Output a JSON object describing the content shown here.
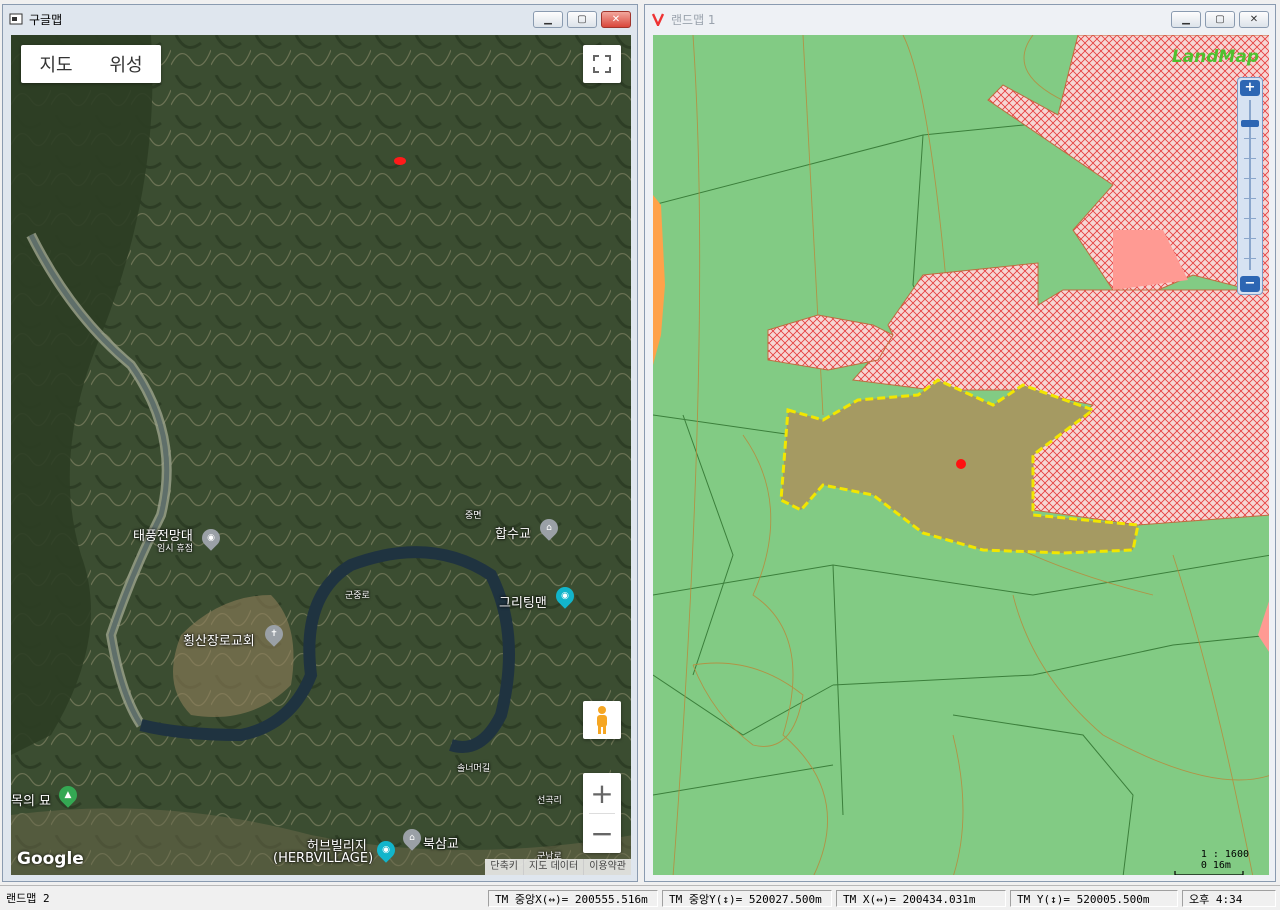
{
  "google_window": {
    "title": "구글맵",
    "map_type": {
      "map": "지도",
      "satellite": "위성"
    },
    "places": [
      {
        "label": "태풍전망대",
        "sub": "임시 휴점"
      },
      {
        "label": "합수교"
      },
      {
        "label": "그리팅맨"
      },
      {
        "label": "횡산장로교회"
      },
      {
        "label": "목의 묘"
      },
      {
        "label": "허브빌리지",
        "sub": "(HERBVILLAGE)"
      },
      {
        "label": "북삼교"
      }
    ],
    "small_labels": [
      "중면",
      "군중로",
      "솔너머길",
      "선곡리",
      "군남로"
    ],
    "zoom_in": "+",
    "zoom_out": "−",
    "logo": "Google",
    "footer": [
      "단축키",
      "지도 데이터",
      "이용약관"
    ]
  },
  "land_window": {
    "title": "랜드맵 1",
    "logo": "LandMap",
    "scale_ratio": "1 : 1600",
    "scale_zero": "0",
    "scale_length": "16m",
    "colors": {
      "base": "#82cb84",
      "hatch": "#e63b3b",
      "parcel": "#a59a62",
      "outline": "#f2e600"
    }
  },
  "statusbar": {
    "app": "랜드맵 2",
    "center_x": "TM 중앙X(↔)= 200555.516m",
    "center_y": "TM 중앙Y(↕)= 520027.500m",
    "tm_x": "TM X(↔)= 200434.031m",
    "tm_y": "TM Y(↕)= 520005.500m",
    "clock": "오후 4:34"
  }
}
